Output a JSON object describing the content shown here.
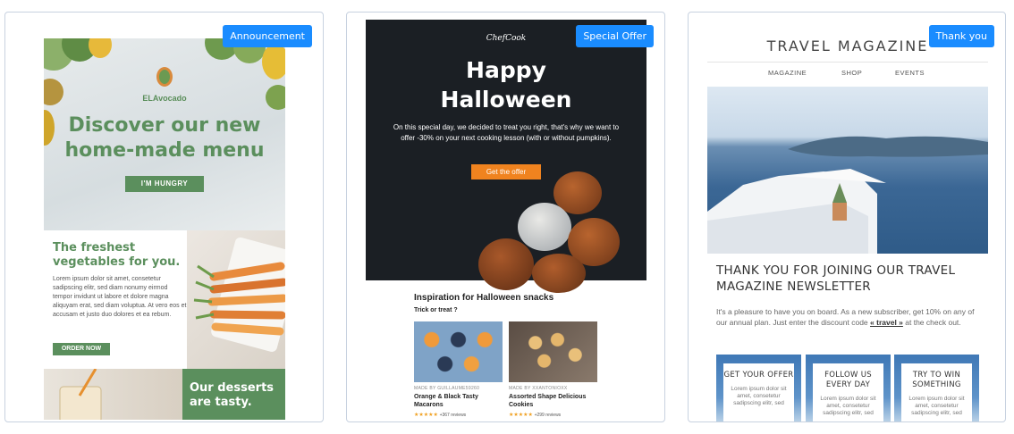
{
  "cards": [
    {
      "badge": "Announcement",
      "logo": "ELAvocado",
      "headline": "Discover our new home-made menu",
      "cta": "I'M HUNGRY",
      "subhead": "The freshest vegetables for you.",
      "body": "Lorem ipsum dolor sit amet, consetetur sadipscing elitr, sed diam nonumy eirmod tempor invidunt ut labore et dolore magna aliquyam erat, sed diam voluptua. At vero eos et accusam et justo duo dolores et ea rebum.",
      "cta2": "ORDER NOW",
      "footer_head": "Our desserts are tasty."
    },
    {
      "badge": "Special Offer",
      "logo": "ChefCook",
      "headline": "Happy Halloween",
      "body": "On this special day, we decided to treat you right, that's why we want to offer -30% on your next cooking lesson (with or without pumpkins).",
      "cta": "Get the offer",
      "section_title": "Inspiration for Halloween snacks",
      "section_sub": "Trick or treat ?",
      "products": [
        {
          "by": "MADE BY GUILLAUME59260",
          "name": "Orange & Black Tasty Macarons",
          "stars": "★★★★★",
          "reviews": "+367 reviews"
        },
        {
          "by": "MADE BY XXANTONIOXX",
          "name": "Assorted Shape Delicious Cookies",
          "stars": "★★★★★",
          "reviews": "+299 reviews"
        }
      ]
    },
    {
      "badge": "Thank you",
      "title": "TRAVEL MAGAZINE",
      "nav": [
        "MAGAZINE",
        "SHOP",
        "EVENTS"
      ],
      "headline": "THANK YOU FOR JOINING OUR TRAVEL MAGAZINE NEWSLETTER",
      "body_pre": "It's a pleasure to have you on board. As a new subscriber, get 10% on any of our annual plan.  Just enter the discount code",
      "code": "« travel »",
      "body_post": " at the check out.",
      "tiles": [
        {
          "title": "GET YOUR OFFER",
          "desc": "Lorem ipsum dolor sit amet, consetetur sadipscing elitr, sed"
        },
        {
          "title": "FOLLOW US EVERY DAY",
          "desc": "Lorem ipsum dolor sit amet, consetetur sadipscing elitr, sed"
        },
        {
          "title": "TRY TO WIN SOMETHING",
          "desc": "Lorem ipsum dolor sit amet, consetetur sadipscing elitr, sed"
        }
      ]
    }
  ],
  "colors": {
    "badge": "#1a8cff",
    "avocado_green": "#5b8f5d",
    "halloween_orange": "#f0831f",
    "halloween_dark": "#1b1f24"
  }
}
